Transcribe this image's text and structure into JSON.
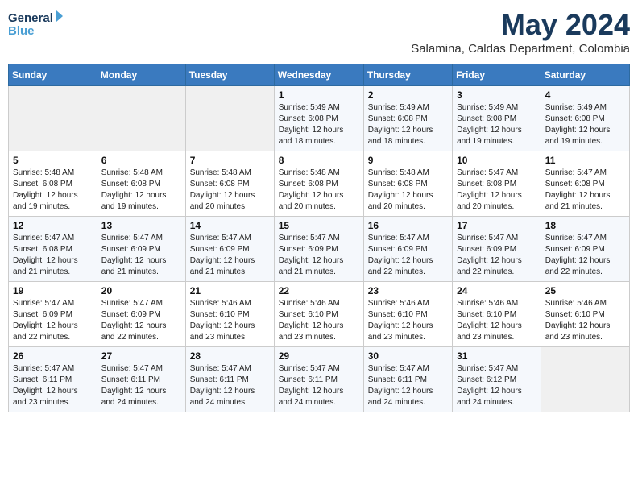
{
  "header": {
    "logo_general": "General",
    "logo_blue": "Blue",
    "month": "May 2024",
    "location": "Salamina, Caldas Department, Colombia"
  },
  "days_of_week": [
    "Sunday",
    "Monday",
    "Tuesday",
    "Wednesday",
    "Thursday",
    "Friday",
    "Saturday"
  ],
  "weeks": [
    [
      {
        "day": "",
        "info": ""
      },
      {
        "day": "",
        "info": ""
      },
      {
        "day": "",
        "info": ""
      },
      {
        "day": "1",
        "info": "Sunrise: 5:49 AM\nSunset: 6:08 PM\nDaylight: 12 hours\nand 18 minutes."
      },
      {
        "day": "2",
        "info": "Sunrise: 5:49 AM\nSunset: 6:08 PM\nDaylight: 12 hours\nand 18 minutes."
      },
      {
        "day": "3",
        "info": "Sunrise: 5:49 AM\nSunset: 6:08 PM\nDaylight: 12 hours\nand 19 minutes."
      },
      {
        "day": "4",
        "info": "Sunrise: 5:49 AM\nSunset: 6:08 PM\nDaylight: 12 hours\nand 19 minutes."
      }
    ],
    [
      {
        "day": "5",
        "info": "Sunrise: 5:48 AM\nSunset: 6:08 PM\nDaylight: 12 hours\nand 19 minutes."
      },
      {
        "day": "6",
        "info": "Sunrise: 5:48 AM\nSunset: 6:08 PM\nDaylight: 12 hours\nand 19 minutes."
      },
      {
        "day": "7",
        "info": "Sunrise: 5:48 AM\nSunset: 6:08 PM\nDaylight: 12 hours\nand 20 minutes."
      },
      {
        "day": "8",
        "info": "Sunrise: 5:48 AM\nSunset: 6:08 PM\nDaylight: 12 hours\nand 20 minutes."
      },
      {
        "day": "9",
        "info": "Sunrise: 5:48 AM\nSunset: 6:08 PM\nDaylight: 12 hours\nand 20 minutes."
      },
      {
        "day": "10",
        "info": "Sunrise: 5:47 AM\nSunset: 6:08 PM\nDaylight: 12 hours\nand 20 minutes."
      },
      {
        "day": "11",
        "info": "Sunrise: 5:47 AM\nSunset: 6:08 PM\nDaylight: 12 hours\nand 21 minutes."
      }
    ],
    [
      {
        "day": "12",
        "info": "Sunrise: 5:47 AM\nSunset: 6:08 PM\nDaylight: 12 hours\nand 21 minutes."
      },
      {
        "day": "13",
        "info": "Sunrise: 5:47 AM\nSunset: 6:09 PM\nDaylight: 12 hours\nand 21 minutes."
      },
      {
        "day": "14",
        "info": "Sunrise: 5:47 AM\nSunset: 6:09 PM\nDaylight: 12 hours\nand 21 minutes."
      },
      {
        "day": "15",
        "info": "Sunrise: 5:47 AM\nSunset: 6:09 PM\nDaylight: 12 hours\nand 21 minutes."
      },
      {
        "day": "16",
        "info": "Sunrise: 5:47 AM\nSunset: 6:09 PM\nDaylight: 12 hours\nand 22 minutes."
      },
      {
        "day": "17",
        "info": "Sunrise: 5:47 AM\nSunset: 6:09 PM\nDaylight: 12 hours\nand 22 minutes."
      },
      {
        "day": "18",
        "info": "Sunrise: 5:47 AM\nSunset: 6:09 PM\nDaylight: 12 hours\nand 22 minutes."
      }
    ],
    [
      {
        "day": "19",
        "info": "Sunrise: 5:47 AM\nSunset: 6:09 PM\nDaylight: 12 hours\nand 22 minutes."
      },
      {
        "day": "20",
        "info": "Sunrise: 5:47 AM\nSunset: 6:09 PM\nDaylight: 12 hours\nand 22 minutes."
      },
      {
        "day": "21",
        "info": "Sunrise: 5:46 AM\nSunset: 6:10 PM\nDaylight: 12 hours\nand 23 minutes."
      },
      {
        "day": "22",
        "info": "Sunrise: 5:46 AM\nSunset: 6:10 PM\nDaylight: 12 hours\nand 23 minutes."
      },
      {
        "day": "23",
        "info": "Sunrise: 5:46 AM\nSunset: 6:10 PM\nDaylight: 12 hours\nand 23 minutes."
      },
      {
        "day": "24",
        "info": "Sunrise: 5:46 AM\nSunset: 6:10 PM\nDaylight: 12 hours\nand 23 minutes."
      },
      {
        "day": "25",
        "info": "Sunrise: 5:46 AM\nSunset: 6:10 PM\nDaylight: 12 hours\nand 23 minutes."
      }
    ],
    [
      {
        "day": "26",
        "info": "Sunrise: 5:47 AM\nSunset: 6:11 PM\nDaylight: 12 hours\nand 23 minutes."
      },
      {
        "day": "27",
        "info": "Sunrise: 5:47 AM\nSunset: 6:11 PM\nDaylight: 12 hours\nand 24 minutes."
      },
      {
        "day": "28",
        "info": "Sunrise: 5:47 AM\nSunset: 6:11 PM\nDaylight: 12 hours\nand 24 minutes."
      },
      {
        "day": "29",
        "info": "Sunrise: 5:47 AM\nSunset: 6:11 PM\nDaylight: 12 hours\nand 24 minutes."
      },
      {
        "day": "30",
        "info": "Sunrise: 5:47 AM\nSunset: 6:11 PM\nDaylight: 12 hours\nand 24 minutes."
      },
      {
        "day": "31",
        "info": "Sunrise: 5:47 AM\nSunset: 6:12 PM\nDaylight: 12 hours\nand 24 minutes."
      },
      {
        "day": "",
        "info": ""
      }
    ]
  ]
}
